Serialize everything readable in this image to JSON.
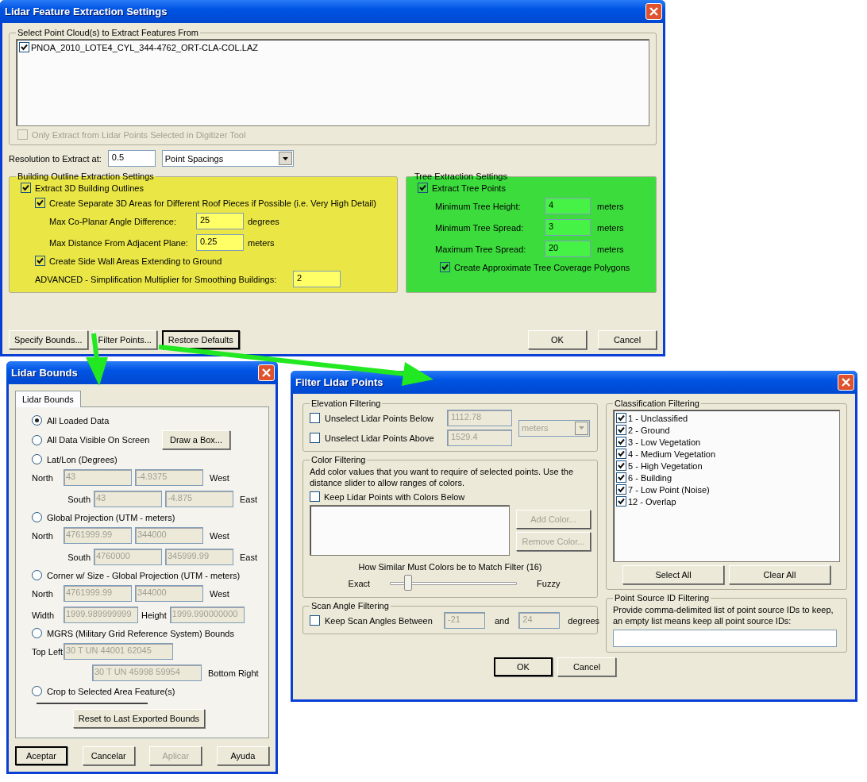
{
  "main_window": {
    "title": "Lidar Feature Extraction Settings",
    "point_clouds": {
      "label": "Select Point Cloud(s) to Extract Features From",
      "files": [
        {
          "name": "PNOA_2010_LOTE4_CYL_344-4762_ORT-CLA-COL.LAZ",
          "checked": true
        }
      ],
      "selected_only": {
        "label": "Only Extract from Lidar Points Selected in Digitizer Tool",
        "checked": false,
        "disabled": true
      }
    },
    "resolution": {
      "label": "Resolution to Extract at:",
      "value": "0.5",
      "unit": "Point Spacings"
    },
    "building": {
      "label": "Building Outline Extraction Settings",
      "color": "#e9e646",
      "extract": {
        "label": "Extract 3D Building Outlines",
        "checked": true
      },
      "separate": {
        "label": "Create Separate 3D Areas for Different Roof Pieces if Possible (i.e. Very High Detail)",
        "checked": true
      },
      "fields": [
        {
          "label": "Max Co-Planar Angle Difference:",
          "value": "25",
          "unit": "degrees"
        },
        {
          "label": "Max Distance From Adjacent Plane:",
          "value": "0.25",
          "unit": "meters"
        }
      ],
      "side_walls": {
        "label": "Create Side Wall Areas Extending to Ground",
        "checked": true
      },
      "advanced": {
        "label": "ADVANCED - Simplification Multiplier for Smoothing Buildings:",
        "value": "2"
      }
    },
    "tree": {
      "label": "Tree Extraction Settings",
      "color": "#3ddc3d",
      "extract": {
        "label": "Extract Tree Points",
        "checked": true
      },
      "fields": [
        {
          "label": "Minimum Tree Height:",
          "value": "4",
          "unit": "meters"
        },
        {
          "label": "Minimum Tree Spread:",
          "value": "3",
          "unit": "meters"
        },
        {
          "label": "Maximum Tree Spread:",
          "value": "20",
          "unit": "meters"
        }
      ],
      "polygons": {
        "label": "Create Approximate Tree Coverage Polygons",
        "checked": true
      }
    },
    "left_buttons": [
      {
        "label": "Specify Bounds...",
        "default": false
      },
      {
        "label": "Filter Points...",
        "default": false
      },
      {
        "label": "Restore Defaults",
        "default": true
      }
    ],
    "right_buttons": [
      {
        "label": "OK",
        "default": false
      },
      {
        "label": "Cancel",
        "default": false
      }
    ]
  },
  "bounds_window": {
    "title": "Lidar Bounds",
    "tab": {
      "label": "Lidar Bounds",
      "selected": true
    },
    "options": [
      {
        "label": "All Loaded Data",
        "selected": true
      },
      {
        "label": "All Data Visible On Screen",
        "selected": false,
        "button": "Draw a Box..."
      },
      {
        "label": "Lat/Lon (Degrees)",
        "selected": false,
        "rows": [
          {
            "kind": "pair",
            "label": "North",
            "values": [
              "43",
              "-4.9375"
            ],
            "suffix": "West"
          },
          {
            "kind": "indent",
            "label": "South",
            "values": [
              "43",
              "-4.875"
            ],
            "suffix": "East"
          }
        ]
      },
      {
        "label": "Global Projection (UTM - meters)",
        "selected": false,
        "rows": [
          {
            "kind": "pair",
            "label": "North",
            "values": [
              "4761999.99",
              "344000"
            ],
            "suffix": "West"
          },
          {
            "kind": "indent",
            "label": "South",
            "values": [
              "4760000",
              "345999.99"
            ],
            "suffix": "East"
          }
        ]
      },
      {
        "label": "Corner w/ Size - Global Projection (UTM - meters)",
        "selected": false,
        "rows": [
          {
            "kind": "pair",
            "label": "North",
            "values": [
              "4761999.99",
              "344000"
            ],
            "suffix": "West"
          },
          {
            "kind": "size",
            "label": "Width",
            "values": [
              "1999.989999999",
              "1999.990000000"
            ],
            "middle": "Height"
          }
        ]
      },
      {
        "label": "MGRS (Military Grid Reference System) Bounds",
        "selected": false,
        "rows": [
          {
            "kind": "single",
            "label": "Top Left",
            "values": [
              "30 T UN 44001 62045"
            ]
          },
          {
            "kind": "trailing",
            "values": [
              "30 T UN 45998 59954"
            ],
            "suffix": "Bottom Right"
          }
        ]
      },
      {
        "label": "Crop to Selected Area Feature(s)",
        "selected": false
      }
    ],
    "reset_button": "Reset to Last Exported Bounds",
    "buttons": [
      {
        "label": "Aceptar",
        "default": true,
        "disabled": false
      },
      {
        "label": "Cancelar",
        "default": false,
        "disabled": false
      },
      {
        "label": "Aplicar",
        "default": false,
        "disabled": true
      },
      {
        "label": "Ayuda",
        "default": false,
        "disabled": false
      }
    ]
  },
  "filter_window": {
    "title": "Filter Lidar Points",
    "elevation": {
      "label": "Elevation Filtering",
      "rows": [
        {
          "label": "Unselect Lidar Points Below",
          "checked": false,
          "value": "1112.78"
        },
        {
          "label": "Unselect Lidar Points Above",
          "checked": false,
          "value": "1529.4"
        }
      ],
      "unit": "meters"
    },
    "color": {
      "label": "Color Filtering",
      "description": "Add color values that you want to require of selected points. Use the distance slider to allow ranges of colors.",
      "keep": {
        "label": "Keep Lidar Points with Colors Below",
        "checked": false
      },
      "buttons": [
        {
          "label": "Add Color...",
          "disabled": true
        },
        {
          "label": "Remove Color...",
          "disabled": true
        }
      ],
      "slider_label": "How Similar Must Colors be to Match Filter (16)",
      "min_label": "Exact",
      "max_label": "Fuzzy",
      "level": 0.14
    },
    "scan_angle": {
      "label": "Scan Angle Filtering",
      "keep": {
        "label": "Keep Scan Angles Between",
        "checked": false
      },
      "from": "-21",
      "and": "and",
      "to": "24",
      "unit": "degrees"
    },
    "classification": {
      "label": "Classification Filtering",
      "items": [
        {
          "label": "1 - Unclassified",
          "checked": true
        },
        {
          "label": "2 - Ground",
          "checked": true
        },
        {
          "label": "3 - Low Vegetation",
          "checked": true
        },
        {
          "label": "4 - Medium Vegetation",
          "checked": true
        },
        {
          "label": "5 - High Vegetation",
          "checked": true
        },
        {
          "label": "6 - Building",
          "checked": true
        },
        {
          "label": "7 - Low Point (Noise)",
          "checked": true
        },
        {
          "label": "12 - Overlap",
          "checked": true
        }
      ],
      "buttons": [
        "Select All",
        "Clear All"
      ]
    },
    "point_source": {
      "label": "Point Source ID Filtering",
      "description": "Provide comma-delimited list of point source IDs to keep, an empty list means keep all point source IDs:"
    },
    "buttons": [
      {
        "label": "OK",
        "default": true
      },
      {
        "label": "Cancel",
        "default": false
      }
    ]
  }
}
